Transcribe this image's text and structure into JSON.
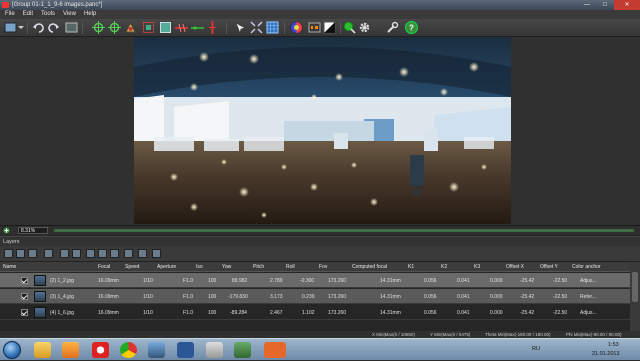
{
  "window": {
    "title": "[Group 01-1_1_9-6 images.panc*]",
    "min": "—",
    "max": "□",
    "close": "✕"
  },
  "menu": [
    "File",
    "Edit",
    "Tools",
    "View",
    "Help"
  ],
  "toolbar_icons": [
    "new-project-icon",
    "undo-icon",
    "redo-icon",
    "move-icon",
    "rotate-icon",
    "zoom-region-icon",
    "select-icon",
    "crop-icon",
    "horizon-icon",
    "level-icon",
    "control-points-icon",
    "align-icon",
    "transform-icon",
    "vertical-line-icon",
    "color-correct-icon",
    "mask-icon",
    "preview-icon",
    "settings-icon",
    "tools-icon",
    "help-icon"
  ],
  "zoom": {
    "value": "8.31%"
  },
  "layers": {
    "title": "Layers"
  },
  "grid": {
    "headers": [
      "Name",
      "Focal",
      "Speed",
      "Aperture",
      "Iso",
      "Yaw",
      "Pitch",
      "Roll",
      "Fov",
      "Computed focal",
      "K1",
      "K2",
      "K3",
      "Offset X",
      "Offset Y",
      "Color anchor"
    ],
    "rows": [
      {
        "name": "(2) 1_2.jpg",
        "focal": "16.09mm",
        "speed": "1/10",
        "aperture": "F1.0",
        "iso": "100",
        "yaw": "89.982",
        "pitch": "2.789",
        "roll": "-0.300",
        "fov": "173.260",
        "computed": "14.31mm",
        "k1": "0.056",
        "k2": "0.041",
        "k3": "0.000",
        "offx": "-25.42",
        "offy": "-22.50",
        "anchor": "Adjus...",
        "checked": true
      },
      {
        "name": "(3) 1_4.jpg",
        "focal": "16.09mm",
        "speed": "1/10",
        "aperture": "F1.0",
        "iso": "100",
        "yaw": "-179.830",
        "pitch": "3.173",
        "roll": "0.239",
        "fov": "173.260",
        "computed": "14.31mm",
        "k1": "0.056",
        "k2": "0.041",
        "k3": "0.000",
        "offx": "-25.42",
        "offy": "-22.50",
        "anchor": "Refer...",
        "checked": true
      },
      {
        "name": "(4) 1_6.jpg",
        "focal": "16.09mm",
        "speed": "1/10",
        "aperture": "F1.0",
        "iso": "100",
        "yaw": "-89.284",
        "pitch": "2.467",
        "roll": "1.102",
        "fov": "173.260",
        "computed": "14.31mm",
        "k1": "0.056",
        "k2": "0.041",
        "k3": "0.000",
        "offx": "-25.42",
        "offy": "-22.50",
        "anchor": "Adjus...",
        "checked": true
      }
    ]
  },
  "status": {
    "xminmax": "X Min|Max(0 / 10650)",
    "yminmax": "Y Min|Max(0 / 5475)",
    "theta": "Theta Min|Max(-180.00 / 180.00)",
    "phi": "Phi Min|Max(-90.00 / 90.00)"
  },
  "taskbar": {
    "lang": "RU",
    "time": "1:53",
    "date": "21.01.2013"
  },
  "colors": {
    "accent": "#3e6b48",
    "selection": "#6a6a6a",
    "taskbar": "#7d98b3"
  }
}
